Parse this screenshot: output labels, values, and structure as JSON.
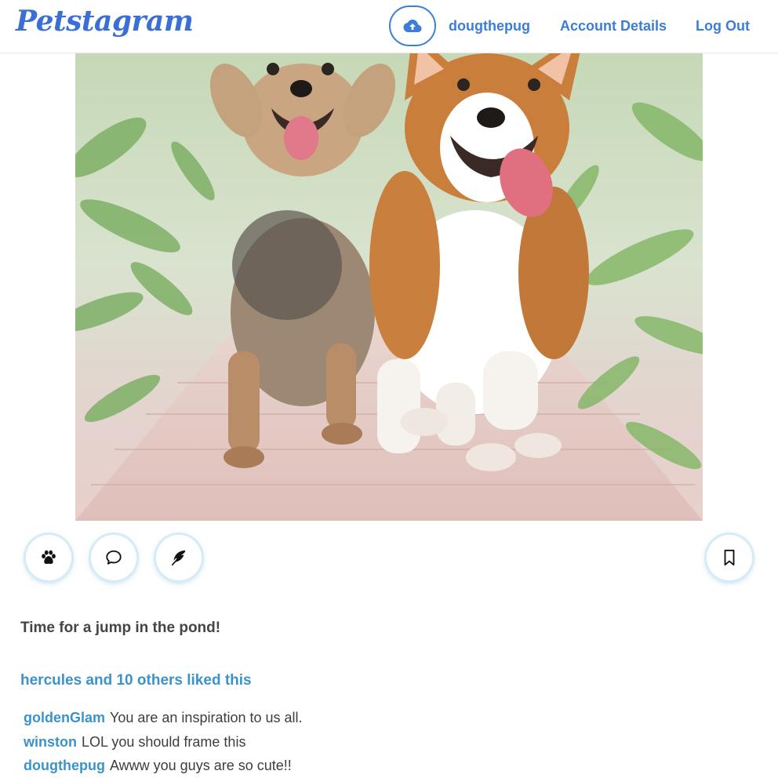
{
  "header": {
    "logo": "Petstagram",
    "upload_icon": "cloud-upload-icon",
    "username": "dougthepug",
    "account_details": "Account Details",
    "log_out": "Log Out",
    "accent_color": "#3b7dd8"
  },
  "post": {
    "image_alt": "Two dogs running on a brick path",
    "actions": {
      "like_icon": "paw-icon",
      "comment_icon": "speech-bubble-icon",
      "share_icon": "feather-icon",
      "save_icon": "bookmark-icon"
    },
    "caption": "Time for a jump in the pond!",
    "likes_text": "hercules and 10 others liked this",
    "comments": [
      {
        "user": "goldenGlam",
        "text": "You are an inspiration to us all."
      },
      {
        "user": "winston",
        "text": "LOL you should frame this"
      },
      {
        "user": "dougthepug",
        "text": "Awww you guys are so cute!!"
      }
    ]
  }
}
